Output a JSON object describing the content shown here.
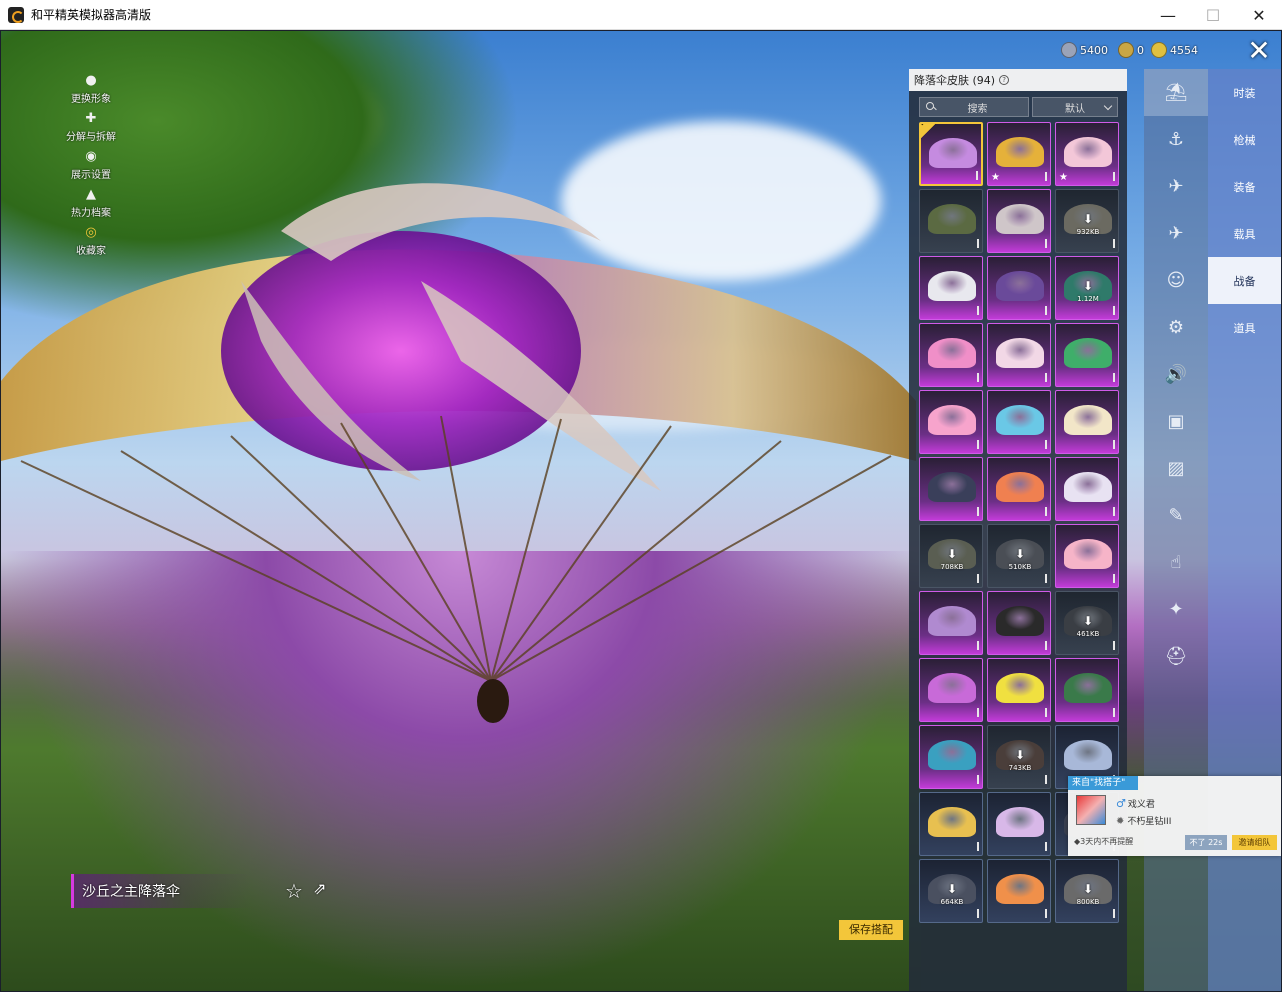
{
  "window": {
    "title": "和平精英模拟器高清版",
    "min": "—",
    "max": "☐",
    "close": "✕"
  },
  "left_menu": [
    {
      "label": "更换形象",
      "icon": "person-icon"
    },
    {
      "label": "分解与拆解",
      "icon": "puzzle-icon"
    },
    {
      "label": "展示设置",
      "icon": "eye-icon"
    },
    {
      "label": "热力档案",
      "icon": "flame-icon"
    },
    {
      "label": "收藏家",
      "icon": "collector-badge-icon"
    }
  ],
  "currency": [
    {
      "value": "5400",
      "color": "#9aa3b8"
    },
    {
      "value": "0",
      "color": "#c9a645"
    },
    {
      "value": "4554",
      "color": "#e0c040"
    }
  ],
  "close_glyph": "✕",
  "panel": {
    "title": "降落伞皮肤 (94)",
    "help": "?",
    "search_label": "搜索",
    "sort_label": "默认"
  },
  "tiles": [
    {
      "rarity": "purple",
      "color": "#c58be0",
      "selected": true
    },
    {
      "rarity": "purple",
      "color": "#e5b13a",
      "star": true
    },
    {
      "rarity": "purple",
      "color": "#f3c7d8",
      "star": true
    },
    {
      "rarity": "dark",
      "color": "#5b6a42"
    },
    {
      "rarity": "purple",
      "color": "#cfc6c9"
    },
    {
      "rarity": "dark",
      "color": "#6b6a61",
      "size": "932KB"
    },
    {
      "rarity": "purple",
      "color": "#e8e8ee"
    },
    {
      "rarity": "purple",
      "color": "#6a4a9a"
    },
    {
      "rarity": "purple",
      "color": "#2f7a6a",
      "size": "1.12M"
    },
    {
      "rarity": "purple",
      "color": "#f08fc8"
    },
    {
      "rarity": "purple",
      "color": "#f2d8e6"
    },
    {
      "rarity": "purple",
      "color": "#3fae6a"
    },
    {
      "rarity": "purple",
      "color": "#f7a4cc"
    },
    {
      "rarity": "purple",
      "color": "#6ac8e6"
    },
    {
      "rarity": "purple",
      "color": "#f2e6c8"
    },
    {
      "rarity": "purple",
      "color": "#3a3f5a"
    },
    {
      "rarity": "purple",
      "color": "#f08050"
    },
    {
      "rarity": "purple",
      "color": "#e8e2f2"
    },
    {
      "rarity": "dark",
      "color": "#5a5e52",
      "size": "708KB"
    },
    {
      "rarity": "dark",
      "color": "#4a4e55",
      "size": "510KB"
    },
    {
      "rarity": "purple",
      "color": "#f6b4c8"
    },
    {
      "rarity": "purple",
      "color": "#b08ad0"
    },
    {
      "rarity": "purple",
      "color": "#2a2a2a"
    },
    {
      "rarity": "dark",
      "color": "#3a3e44",
      "size": "461KB"
    },
    {
      "rarity": "purple",
      "color": "#c86ad8"
    },
    {
      "rarity": "purple",
      "color": "#f0e040"
    },
    {
      "rarity": "purple",
      "color": "#3a7a4a"
    },
    {
      "rarity": "purple",
      "color": "#3aa0c0"
    },
    {
      "rarity": "dark",
      "color": "#4a3e3a",
      "size": "743KB"
    },
    {
      "rarity": "blue",
      "color": "#a8b8d8"
    },
    {
      "rarity": "blue",
      "color": "#e8c050"
    },
    {
      "rarity": "blue",
      "color": "#d8b8e8"
    },
    {
      "rarity": "blue",
      "color": "#3a4050"
    },
    {
      "rarity": "blue",
      "color": "#4a5060",
      "size": "664KB"
    },
    {
      "rarity": "blue",
      "color": "#f0904a"
    },
    {
      "rarity": "blue",
      "color": "#6a6a6a",
      "size": "800KB"
    }
  ],
  "categories": [
    {
      "label": "时装",
      "icon": "fashion-icon"
    },
    {
      "label": "枪械",
      "icon": "gun-icon"
    },
    {
      "label": "装备",
      "icon": "equipment-icon"
    },
    {
      "label": "载具",
      "icon": "vehicle-icon"
    },
    {
      "label": "战备",
      "icon": "combat-gear-icon",
      "active": true
    },
    {
      "label": "道具",
      "icon": "item-icon"
    }
  ],
  "cat_glyphs": [
    "⛱",
    "⚓",
    "✈",
    "✈",
    "☺",
    "⚙",
    "🔊",
    "▣",
    "▨",
    "✎",
    "☝",
    "✦",
    "⛑"
  ],
  "invite": {
    "from": "来自\"找搭子\"",
    "name": "戏义君",
    "rank": "不朽星钻III",
    "note": "◆3天内不再提醒",
    "decline": "不了 22s",
    "accept": "邀请组队"
  },
  "skin_name": "沙丘之主降落伞",
  "save_label": "保存搭配"
}
